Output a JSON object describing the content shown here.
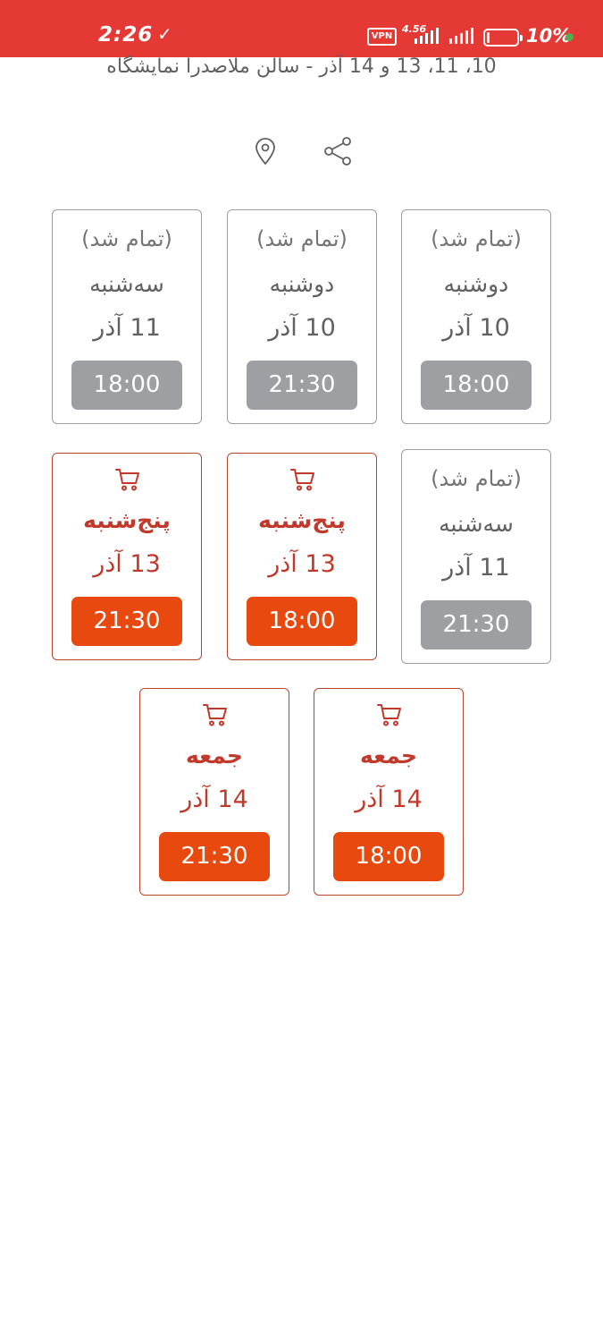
{
  "status_bar": {
    "time": "2:26",
    "notification_glyph": "✓",
    "vpn_label": "VPN",
    "network_label": "4.56",
    "battery_level": 0.1,
    "battery_label": "10%",
    "icons": [
      "vpn-icon",
      "signal-icon",
      "signal-icon",
      "battery-icon",
      "dot-indicator"
    ]
  },
  "event": {
    "subtitle": "10، 11، 13 و 14 آذر - سالن ملاصدرا نمایشگاه"
  },
  "actions": {
    "icons": [
      "share-icon",
      "location-icon"
    ]
  },
  "showtimes": [
    {
      "status": "(تمام شد)",
      "day": "دوشنبه",
      "date": "10 آذر",
      "time": "18:00",
      "available": false
    },
    {
      "status": "(تمام شد)",
      "day": "دوشنبه",
      "date": "10 آذر",
      "time": "21:30",
      "available": false
    },
    {
      "status": "(تمام شد)",
      "day": "سه‌شنبه",
      "date": "11 آذر",
      "time": "18:00",
      "available": false
    },
    {
      "status": "(تمام شد)",
      "day": "سه‌شنبه",
      "date": "11 آذر",
      "time": "21:30",
      "available": false
    },
    {
      "icon": "cart-icon",
      "day": "پنج‌شنبه",
      "date": "13 آذر",
      "time": "18:00",
      "available": true
    },
    {
      "icon": "cart-icon",
      "day": "پنج‌شنبه",
      "date": "13 آذر",
      "time": "21:30",
      "available": true
    },
    {
      "icon": "cart-icon",
      "day": "جمعه",
      "date": "14 آذر",
      "time": "18:00",
      "available": true
    },
    {
      "icon": "cart-icon",
      "day": "جمعه",
      "date": "14 آذر",
      "time": "21:30",
      "available": true
    }
  ],
  "colors": {
    "status_bar": "#e53935",
    "available_accent": "#e8490e",
    "available_text": "#c0392b",
    "sold_out_button": "#9e9fa3",
    "text_muted": "#616161"
  }
}
